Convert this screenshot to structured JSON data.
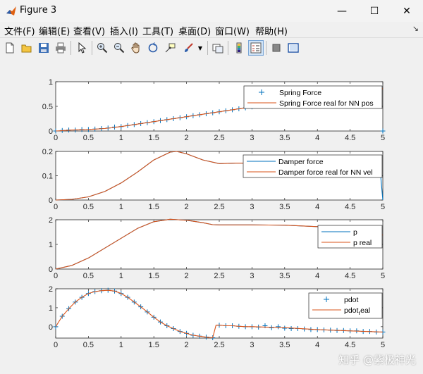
{
  "window": {
    "title": "Figure 3"
  },
  "window_controls": {
    "minimize": "—",
    "maximize": "☐",
    "close": "✕"
  },
  "menubar": {
    "items": [
      {
        "label": "文件(F)"
      },
      {
        "label": "编辑(E)"
      },
      {
        "label": "查看(V)"
      },
      {
        "label": "插入(I)"
      },
      {
        "label": "工具(T)"
      },
      {
        "label": "桌面(D)"
      },
      {
        "label": "窗口(W)"
      },
      {
        "label": "帮助(H)"
      }
    ],
    "overflow_arrow": "↘"
  },
  "toolbar": {
    "buttons": [
      "new-figure",
      "open-file",
      "save",
      "print",
      "select-arrow",
      "zoom-in",
      "zoom-out",
      "pan",
      "rotate-3d",
      "data-cursor",
      "brush",
      "link-plot",
      "colorbar",
      "legend",
      "hide-plot-tools",
      "show-plot-tools"
    ]
  },
  "watermark": "知乎 @紫极神光",
  "colors": {
    "blue": "#0072BD",
    "orange": "#D95319",
    "axis": "#262626"
  },
  "chart_data": [
    {
      "type": "line",
      "xlim": [
        0,
        5
      ],
      "ylim": [
        0,
        1
      ],
      "xticks": [
        "0",
        "0.5",
        "1",
        "1.5",
        "2",
        "2.5",
        "3",
        "3.5",
        "4",
        "4.5",
        "5"
      ],
      "yticks": [
        "0",
        "0.5",
        "1"
      ],
      "legend_position": "top-right",
      "series": [
        {
          "name": "Spring Force",
          "marker": "+",
          "color": "#0072BD",
          "x": [
            0,
            0.1,
            0.2,
            0.3,
            0.4,
            0.5,
            0.6,
            0.7,
            0.8,
            0.9,
            1.0,
            1.1,
            1.2,
            1.3,
            1.4,
            1.5,
            1.6,
            1.7,
            1.8,
            1.9,
            2.0,
            2.1,
            2.2,
            2.3,
            2.4,
            2.5,
            2.6,
            2.7,
            2.8,
            2.9,
            3.0,
            3.1,
            3.2,
            3.3,
            3.4,
            3.5,
            3.6,
            3.7,
            3.8,
            3.9,
            4.0,
            4.1,
            4.2,
            4.3,
            4.4,
            4.5,
            4.6,
            4.7,
            4.8,
            4.9,
            5.0
          ],
          "y": [
            0,
            0.01,
            0.02,
            0.02,
            0.03,
            0.03,
            0.04,
            0.05,
            0.06,
            0.08,
            0.09,
            0.11,
            0.13,
            0.15,
            0.17,
            0.19,
            0.21,
            0.23,
            0.25,
            0.27,
            0.29,
            0.31,
            0.33,
            0.35,
            0.37,
            0.39,
            0.41,
            0.43,
            0.45,
            0.47,
            0.49,
            0.51,
            0.53,
            0.55,
            0.57,
            0.59,
            0.61,
            0.63,
            0.65,
            0.67,
            0.69,
            0.7,
            0.72,
            0.74,
            0.76,
            0.78,
            0.79,
            0.81,
            0.83,
            0.85,
            0.0
          ]
        },
        {
          "name": "Spring Force real for NN pos",
          "color": "#D95319",
          "x": [
            0,
            0.25,
            0.5,
            0.75,
            1.0,
            1.25,
            1.5,
            1.75,
            2.0,
            2.25,
            2.5,
            2.75,
            3.0,
            3.25,
            3.5,
            3.75,
            4.0,
            4.25,
            4.5,
            4.75,
            5.0
          ],
          "y": [
            0,
            0.02,
            0.03,
            0.05,
            0.09,
            0.14,
            0.19,
            0.24,
            0.29,
            0.34,
            0.39,
            0.44,
            0.49,
            0.54,
            0.59,
            0.64,
            0.69,
            0.73,
            0.78,
            0.82,
            0.86
          ]
        }
      ]
    },
    {
      "type": "line",
      "xlim": [
        0,
        5
      ],
      "ylim": [
        0,
        0.2
      ],
      "xticks": [
        "0",
        "0.5",
        "1",
        "1.5",
        "2",
        "2.5",
        "3",
        "3.5",
        "4",
        "4.5",
        "5"
      ],
      "yticks": [
        "0",
        "0.1",
        "0.2"
      ],
      "legend_position": "top-right",
      "series": [
        {
          "name": "Damper force",
          "color": "#0072BD",
          "x": [
            0,
            0.25,
            0.5,
            0.75,
            1.0,
            1.25,
            1.5,
            1.75,
            1.85,
            2.0,
            2.25,
            2.5,
            2.75,
            3.0,
            3.5,
            4.0,
            4.5,
            4.95,
            5.0
          ],
          "y": [
            0,
            0.003,
            0.013,
            0.035,
            0.07,
            0.115,
            0.165,
            0.197,
            0.2,
            0.19,
            0.165,
            0.15,
            0.152,
            0.152,
            0.152,
            0.152,
            0.152,
            0.152,
            0.0
          ]
        },
        {
          "name": "Damper force real for NN vel",
          "color": "#D95319",
          "x": [
            0,
            0.25,
            0.5,
            0.75,
            1.0,
            1.25,
            1.5,
            1.75,
            1.85,
            2.0,
            2.25,
            2.5,
            2.75,
            3.0,
            3.5,
            4.0,
            4.5,
            4.95
          ],
          "y": [
            0,
            0.003,
            0.013,
            0.035,
            0.07,
            0.115,
            0.165,
            0.197,
            0.2,
            0.19,
            0.165,
            0.15,
            0.152,
            0.152,
            0.152,
            0.152,
            0.152,
            0.152
          ]
        }
      ]
    },
    {
      "type": "line",
      "xlim": [
        0,
        5
      ],
      "ylim": [
        0,
        2
      ],
      "xticks": [
        "0",
        "0.5",
        "1",
        "1.5",
        "2",
        "2.5",
        "3",
        "3.5",
        "4",
        "4.5",
        "5"
      ],
      "yticks": [
        "0",
        "1",
        "2"
      ],
      "legend_position": "top-right",
      "series": [
        {
          "name": "p",
          "color": "#0072BD",
          "x": [
            0,
            0.25,
            0.5,
            0.75,
            1.0,
            1.25,
            1.5,
            1.75,
            2.0,
            2.25,
            2.4,
            2.5,
            3.0,
            3.5,
            4.0,
            4.5,
            5.0
          ],
          "y": [
            0,
            0.15,
            0.45,
            0.85,
            1.25,
            1.65,
            1.92,
            2.02,
            1.98,
            1.88,
            1.8,
            1.79,
            1.79,
            1.78,
            1.72,
            1.55,
            1.38
          ]
        },
        {
          "name": "p real",
          "color": "#D95319",
          "x": [
            0,
            0.25,
            0.5,
            0.75,
            1.0,
            1.25,
            1.5,
            1.75,
            2.0,
            2.25,
            2.4,
            2.5,
            3.0,
            3.5,
            4.0,
            4.5,
            5.0
          ],
          "y": [
            0,
            0.15,
            0.45,
            0.85,
            1.25,
            1.65,
            1.92,
            2.02,
            1.98,
            1.88,
            1.8,
            1.79,
            1.79,
            1.78,
            1.72,
            1.55,
            1.38
          ]
        }
      ]
    },
    {
      "type": "line",
      "xlim": [
        0,
        5
      ],
      "ylim": [
        -0.6,
        2
      ],
      "xticks": [
        "0",
        "0.5",
        "1",
        "1.5",
        "2",
        "2.5",
        "3",
        "3.5",
        "4",
        "4.5",
        "5"
      ],
      "yticks": [
        "0",
        "1",
        "2"
      ],
      "legend_position": "top-right",
      "series": [
        {
          "name": "pdot",
          "marker": "+",
          "color": "#0072BD",
          "x": [
            0,
            0.1,
            0.2,
            0.3,
            0.4,
            0.5,
            0.6,
            0.7,
            0.8,
            0.9,
            1.0,
            1.1,
            1.2,
            1.3,
            1.4,
            1.5,
            1.6,
            1.7,
            1.8,
            1.9,
            2.0,
            2.1,
            2.2,
            2.3,
            2.4,
            2.5,
            2.6,
            2.7,
            2.8,
            2.9,
            3.0,
            3.1,
            3.2,
            3.3,
            3.4,
            3.5,
            3.6,
            3.7,
            3.8,
            3.9,
            4.0,
            4.1,
            4.2,
            4.3,
            4.4,
            4.5,
            4.6,
            4.7,
            4.8,
            4.9,
            5.0
          ],
          "y": [
            0,
            0.55,
            0.95,
            1.3,
            1.55,
            1.75,
            1.85,
            1.9,
            1.92,
            1.88,
            1.75,
            1.55,
            1.3,
            1.05,
            0.78,
            0.5,
            0.25,
            0.05,
            -0.1,
            -0.25,
            -0.35,
            -0.45,
            -0.5,
            -0.55,
            -0.58,
            0.08,
            0.05,
            0.05,
            0.02,
            0.0,
            0.0,
            -0.02,
            0.05,
            -0.05,
            0.0,
            -0.08,
            -0.1,
            -0.1,
            -0.12,
            -0.15,
            -0.15,
            -0.17,
            -0.18,
            -0.2,
            -0.2,
            -0.22,
            -0.22,
            -0.25,
            -0.25,
            -0.28,
            -0.28
          ]
        },
        {
          "name": "pdot_real",
          "color": "#D95319",
          "x": [
            0,
            0.1,
            0.2,
            0.3,
            0.4,
            0.5,
            0.6,
            0.7,
            0.8,
            0.9,
            1.0,
            1.1,
            1.2,
            1.3,
            1.4,
            1.5,
            1.6,
            1.7,
            1.8,
            1.9,
            2.0,
            2.1,
            2.2,
            2.3,
            2.4,
            2.45,
            2.5,
            2.6,
            2.7,
            2.8,
            2.9,
            3.0,
            3.5,
            4.0,
            4.5,
            5.0
          ],
          "y": [
            0,
            0.55,
            0.95,
            1.3,
            1.55,
            1.75,
            1.85,
            1.9,
            1.92,
            1.88,
            1.75,
            1.55,
            1.3,
            1.05,
            0.78,
            0.5,
            0.25,
            0.05,
            -0.1,
            -0.25,
            -0.35,
            -0.45,
            -0.5,
            -0.55,
            -0.58,
            0.08,
            0.08,
            0.05,
            0.05,
            0.02,
            0.0,
            0.0,
            -0.05,
            -0.15,
            -0.22,
            -0.28
          ]
        }
      ]
    }
  ],
  "legends": [
    {
      "entries": [
        "Spring Force",
        "Spring Force real for NN pos"
      ]
    },
    {
      "entries": [
        "Damper force",
        "Damper force real for NN vel"
      ]
    },
    {
      "entries": [
        "p",
        "p real"
      ]
    },
    {
      "entries": [
        "pdot",
        "pdot_real"
      ],
      "labels_display": [
        "pdot",
        "pdot"
      ],
      "subscript_display": "r",
      "suffix_display": "eal"
    }
  ]
}
